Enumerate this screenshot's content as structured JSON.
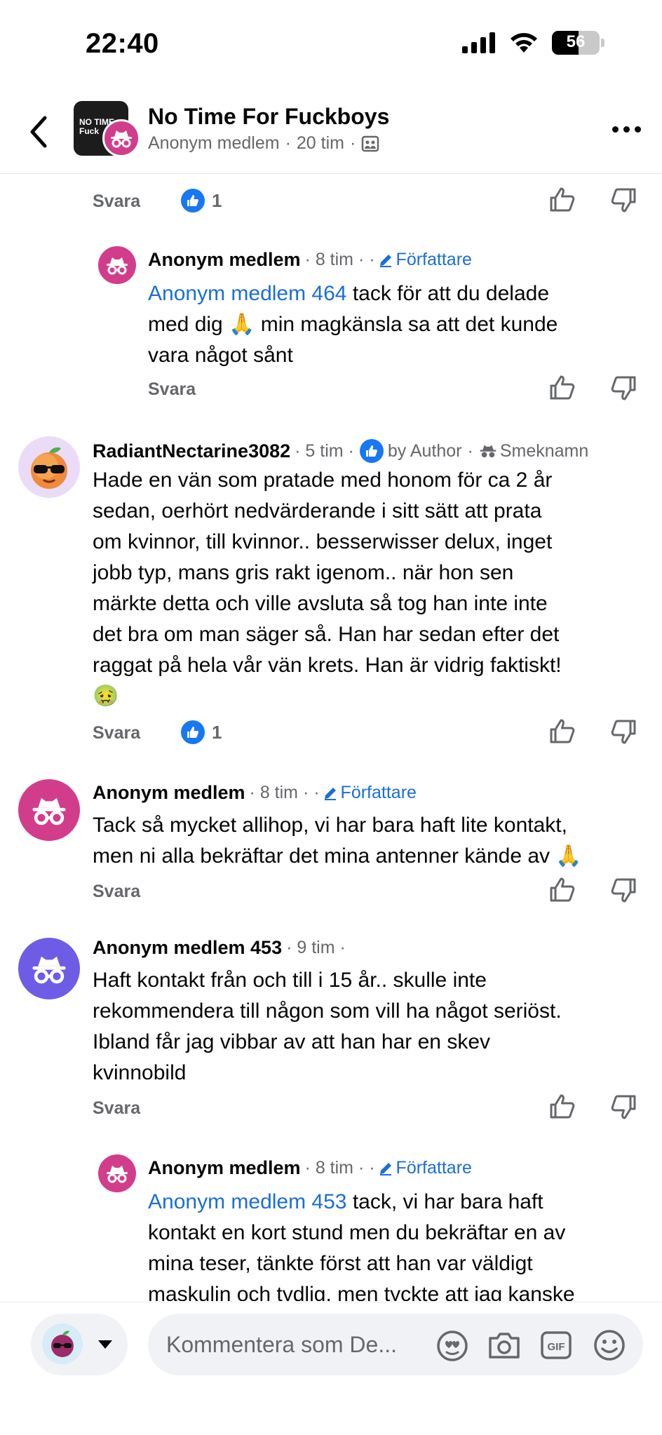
{
  "status_bar": {
    "time": "22:40",
    "battery": "56",
    "battery_level": 0.56
  },
  "header": {
    "group_name": "No Time For Fuckboys",
    "thumb_text": "NO TIME Fuck",
    "poster": "Anonym medlem",
    "time": "20 tim",
    "separator": "·"
  },
  "comments": [
    {
      "id": "c0",
      "partial": true,
      "reply_label": "Svara",
      "like_count": "1"
    },
    {
      "id": "c1",
      "name": "Anonym medlem",
      "meta": "· 8 tim · ·",
      "badge": "Författare",
      "mention": "Anonym medlem 464",
      "text_lines": [
        " tack för att du delade",
        "med dig 🙏 min magkänsla sa att det kunde",
        "vara något sånt"
      ],
      "reply_label": "Svara"
    },
    {
      "id": "c2",
      "name": "RadiantNectarine3082",
      "meta": "· 5 tim ·",
      "liked_by": "by Author",
      "nickname": "Smeknamn",
      "text_lines": [
        "Hade en vän som pratade med honom för ca 2 år",
        "sedan, oerhört nedvärderande i sitt sätt att prata",
        "om kvinnor, till kvinnor.. besserwisser delux, inget",
        "jobb typ, mans gris rakt igenom.. när hon sen",
        "märkte detta och ville avsluta så tog han inte inte",
        "det bra om man säger så. Han har sedan efter det",
        "raggat på hela vår vän krets. Han är vidrig faktiskt!",
        "🤢"
      ],
      "reply_label": "Svara",
      "like_count": "1"
    },
    {
      "id": "c3",
      "name": "Anonym medlem",
      "meta": "· 8 tim · ·",
      "badge": "Författare",
      "text_lines": [
        "Tack så mycket allihop, vi har bara haft lite kontakt,",
        "men ni alla bekräftar det mina antenner kände av 🙏"
      ],
      "reply_label": "Svara"
    },
    {
      "id": "c4",
      "name": "Anonym medlem 453",
      "meta": "· 9 tim ·",
      "text_lines": [
        "Haft kontakt från och till i 15 år.. skulle inte",
        "rekommendera till någon som vill ha något seriöst.",
        "Ibland får jag vibbar av att han har en skev",
        "kvinnobild"
      ],
      "reply_label": "Svara"
    },
    {
      "id": "c5",
      "name": "Anonym medlem",
      "meta": "· 8 tim · ·",
      "badge": "Författare",
      "mention": "Anonym medlem 453",
      "text_lines": [
        " tack, vi har bara haft",
        "kontakt en kort stund men du bekräftar en av",
        "mina teser, tänkte först att han var väldigt",
        "maskulin och tydlig, men tyckte att jag kanske"
      ]
    }
  ],
  "composer": {
    "placeholder": "Kommentera som De..."
  },
  "colors": {
    "accent_blue": "#1877f2",
    "link_blue": "#1a6ed8",
    "anon_pink": "#d23d8b",
    "anon_purple": "#6e5ce6",
    "secondary_text": "#65676b"
  },
  "icons": {
    "back": "chevron-left-icon",
    "more": "more-dots-icon",
    "like": "thumbs-up-icon",
    "dislike": "thumbs-down-icon",
    "author": "pencil-icon",
    "anon": "incognito-icon",
    "camera": "camera-icon",
    "gif": "gif-icon",
    "emoji": "emoji-icon",
    "avatar_sticker": "avatar-sticker-icon"
  }
}
